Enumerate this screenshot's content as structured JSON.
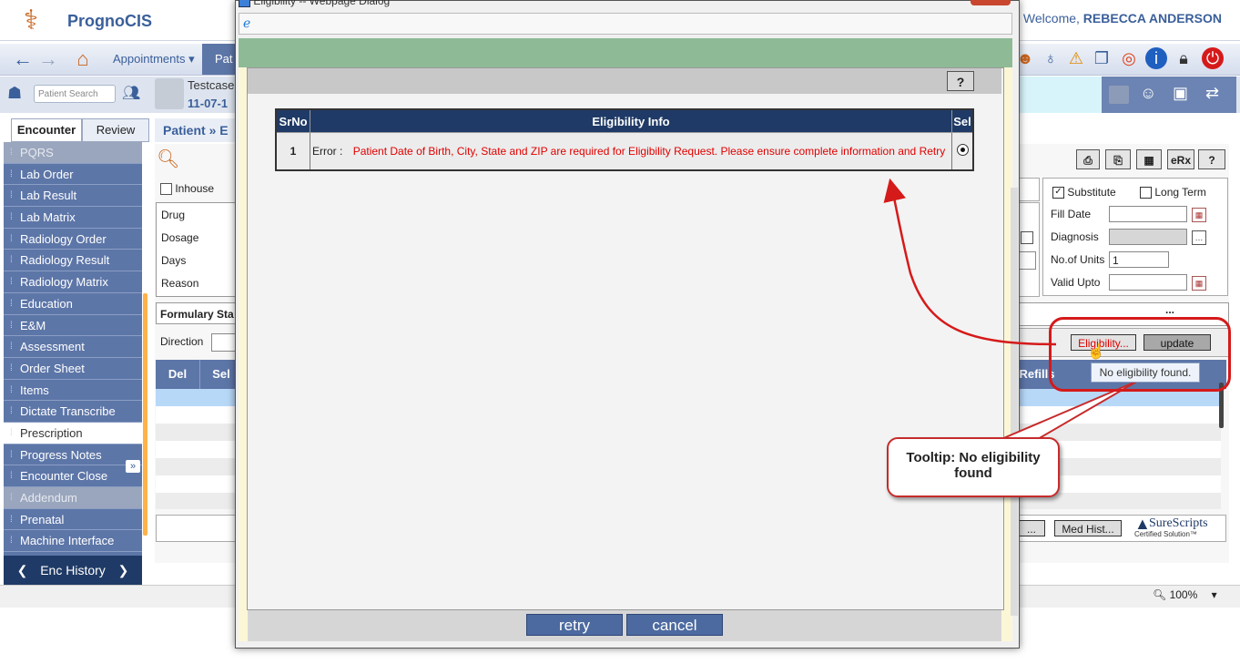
{
  "header": {
    "app_name": "PrognoCIS",
    "welcome_prefix": "Welcome,",
    "user_name": "REBECCA ANDERSON"
  },
  "nav": {
    "appointments": "Appointments ▾",
    "patient": "Pat"
  },
  "patientbar": {
    "search_placeholder": "Patient Search",
    "patient_name": "Testcase",
    "patient_dob": "11-07-1"
  },
  "tabs": {
    "encounter": "Encounter",
    "review": "Review"
  },
  "sidebar": {
    "items": [
      {
        "label": "PQRS",
        "state": "disabled"
      },
      {
        "label": "Lab Order",
        "state": ""
      },
      {
        "label": "Lab Result",
        "state": ""
      },
      {
        "label": "Lab Matrix",
        "state": ""
      },
      {
        "label": "Radiology Order",
        "state": ""
      },
      {
        "label": "Radiology Result",
        "state": ""
      },
      {
        "label": "Radiology Matrix",
        "state": ""
      },
      {
        "label": "Education",
        "state": ""
      },
      {
        "label": "E&M",
        "state": ""
      },
      {
        "label": "Assessment",
        "state": ""
      },
      {
        "label": "Order Sheet",
        "state": ""
      },
      {
        "label": "Items",
        "state": ""
      },
      {
        "label": "Dictate Transcribe",
        "state": ""
      },
      {
        "label": "Prescription",
        "state": "active"
      },
      {
        "label": "Progress Notes",
        "state": ""
      },
      {
        "label": "Encounter Close",
        "state": ""
      },
      {
        "label": "Addendum",
        "state": "disabled"
      },
      {
        "label": "Prenatal",
        "state": ""
      },
      {
        "label": "Machine Interface",
        "state": ""
      }
    ],
    "enc_history": "Enc History"
  },
  "page": {
    "breadcrumb_patient": "Patient",
    "breadcrumb_sep": "»",
    "breadcrumb_next": "E",
    "inhouse": "Inhouse",
    "drug": "Drug",
    "dosage": "Dosage",
    "days": "Days",
    "reason": "Reason",
    "formulary_status": "Formulary Sta",
    "direction": "Direction",
    "grid_del": "Del",
    "grid_sel": "Sel",
    "grid_refills": "Refills",
    "erx": "eRx",
    "help": "?",
    "more": "...",
    "med_hist": "Med Hist...",
    "ellipsis_btn": "...",
    "surescripts": "SureScripts",
    "surescripts_sub": "Certified Solution™",
    "zoom": "100%"
  },
  "rx_panel": {
    "substitute": "Substitute",
    "long_term": "Long Term",
    "fill_date": "Fill Date",
    "diagnosis": "Diagnosis",
    "no_of_units": "No.of Units",
    "no_of_units_value": "1",
    "valid_upto": "Valid Upto",
    "eligibility_btn": "Eligibility...",
    "update_btn": "update",
    "tooltip": "No eligibility found."
  },
  "dialog": {
    "title": "Eligibility -- Webpage Dialog",
    "help": "?",
    "table_headers": {
      "srno": "SrNo",
      "info": "Eligibility Info",
      "sel": "Sel"
    },
    "rows": [
      {
        "srno": "1",
        "prefix": "Error :",
        "message": "Patient Date of Birth, City, State and ZIP are required for Eligibility Request. Please ensure complete information and Retry"
      }
    ],
    "retry": "retry",
    "cancel": "cancel"
  },
  "annotation": {
    "callout": "Tooltip: No eligibility found"
  },
  "colors": {
    "brand_blue": "#3a5f9a",
    "sidebar": "#5d76a8",
    "dark_navy": "#1f3a66",
    "error_red": "#e00000",
    "annotation_red": "#d51a1a",
    "dialog_green": "#8fba96"
  }
}
